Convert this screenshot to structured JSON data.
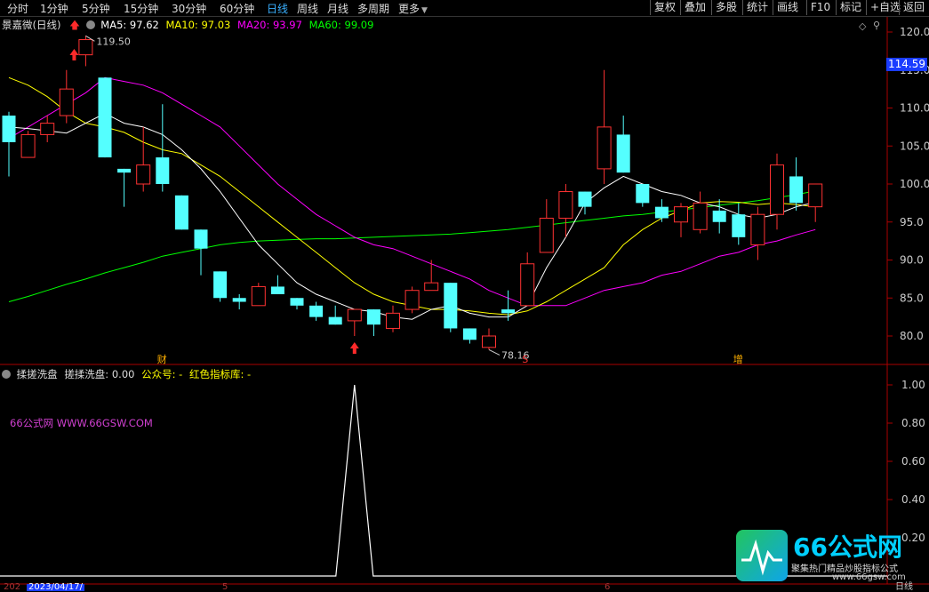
{
  "toolbar": {
    "tabs": [
      "分时",
      "1分钟",
      "5分钟",
      "15分钟",
      "30分钟",
      "60分钟",
      "日线",
      "周线",
      "月线",
      "多周期",
      "更多"
    ],
    "active_tab": "日线",
    "buttons": [
      "复权",
      "叠加",
      "多股",
      "统计",
      "画线",
      "F10",
      "标记",
      "+自选",
      "返回"
    ]
  },
  "main_legend": {
    "stock": "景嘉微(日线)",
    "ma5": "MA5: 97.62",
    "ma10": "MA10: 97.03",
    "ma20": "MA20: 93.97",
    "ma60": "MA60: 99.09",
    "colors": {
      "ma5": "#ffffff",
      "ma10": "#ffff00",
      "ma20": "#ff00ff",
      "ma60": "#00ff00"
    }
  },
  "price_axis": {
    "ticks": [
      "120.0",
      "115.0",
      "110.0",
      "105.0",
      "100.0",
      "95.0",
      "90.0",
      "85.0",
      "80.0"
    ],
    "current_price": "114.59",
    "high_label": "119.50",
    "low_label": "78.16"
  },
  "markers": {
    "cai": "财",
    "s": "S",
    "zeng": "增"
  },
  "sub_legend": {
    "name": "揉搓洗盘",
    "value": "搓揉洗盘: 0.00",
    "gzh": "公众号: -",
    "lib": "红色指标库: -"
  },
  "sub_axis": {
    "ticks": [
      "1.00",
      "0.80",
      "0.60",
      "0.40",
      "0.20"
    ]
  },
  "site_text": "66公式网 WWW.66GSW.COM",
  "bottom": {
    "date": "2023/04/17/",
    "year_prefix": "202",
    "tick_5": "5",
    "tick_6": "6",
    "right": "日线"
  },
  "watermark": {
    "logo": "66公式网",
    "sub": "聚集热门精品炒股指标公式",
    "url": "www.66gsw.com"
  },
  "chart_data": {
    "type": "candlestick",
    "ylim": [
      77,
      122
    ],
    "candles": [
      {
        "o": 109,
        "h": 109.5,
        "l": 101,
        "c": 105.5
      },
      {
        "o": 103.5,
        "h": 107,
        "l": 103.5,
        "c": 106.5
      },
      {
        "o": 106.5,
        "h": 109,
        "l": 105.5,
        "c": 108
      },
      {
        "o": 109,
        "h": 115,
        "l": 108,
        "c": 112.5
      },
      {
        "o": 117,
        "h": 119.5,
        "l": 115.5,
        "c": 119
      },
      {
        "o": 114,
        "h": 114,
        "l": 103.5,
        "c": 103.5
      },
      {
        "o": 102,
        "h": 102,
        "l": 97,
        "c": 101.5
      },
      {
        "o": 100,
        "h": 107.5,
        "l": 99,
        "c": 102.5
      },
      {
        "o": 103.5,
        "h": 110.5,
        "l": 99,
        "c": 100
      },
      {
        "o": 98.5,
        "h": 98.5,
        "l": 94,
        "c": 94
      },
      {
        "o": 94,
        "h": 94,
        "l": 88,
        "c": 91.5
      },
      {
        "o": 88.5,
        "h": 88.5,
        "l": 84.5,
        "c": 85
      },
      {
        "o": 85,
        "h": 85.5,
        "l": 83.5,
        "c": 84.5
      },
      {
        "o": 84,
        "h": 87,
        "l": 84,
        "c": 86.5
      },
      {
        "o": 86.5,
        "h": 88,
        "l": 85.5,
        "c": 85.5
      },
      {
        "o": 85,
        "h": 85,
        "l": 83.5,
        "c": 84
      },
      {
        "o": 84,
        "h": 84.5,
        "l": 82,
        "c": 82.5
      },
      {
        "o": 82.5,
        "h": 84,
        "l": 81.5,
        "c": 81.5
      },
      {
        "o": 82,
        "h": 83.5,
        "l": 80,
        "c": 83.5
      },
      {
        "o": 83.5,
        "h": 83.5,
        "l": 80,
        "c": 81.5
      },
      {
        "o": 81,
        "h": 84,
        "l": 80.5,
        "c": 83
      },
      {
        "o": 83.5,
        "h": 86.5,
        "l": 83,
        "c": 86
      },
      {
        "o": 86,
        "h": 90,
        "l": 86,
        "c": 87
      },
      {
        "o": 87,
        "h": 87,
        "l": 80.5,
        "c": 81
      },
      {
        "o": 81,
        "h": 81,
        "l": 79,
        "c": 79.5
      },
      {
        "o": 78.5,
        "h": 81,
        "l": 78.2,
        "c": 80
      },
      {
        "o": 83.5,
        "h": 86,
        "l": 82,
        "c": 83
      },
      {
        "o": 84,
        "h": 91,
        "l": 84,
        "c": 89.5
      },
      {
        "o": 91,
        "h": 98,
        "l": 91,
        "c": 95.5
      },
      {
        "o": 95.5,
        "h": 100,
        "l": 93,
        "c": 99
      },
      {
        "o": 99,
        "h": 99,
        "l": 96,
        "c": 97
      },
      {
        "o": 102,
        "h": 115,
        "l": 100,
        "c": 107.5
      },
      {
        "o": 106.5,
        "h": 109,
        "l": 101.5,
        "c": 101.5
      },
      {
        "o": 100,
        "h": 100,
        "l": 97,
        "c": 97.5
      },
      {
        "o": 97,
        "h": 98,
        "l": 95,
        "c": 95.5
      },
      {
        "o": 95,
        "h": 97.5,
        "l": 93,
        "c": 97
      },
      {
        "o": 94,
        "h": 99,
        "l": 93.5,
        "c": 97.5
      },
      {
        "o": 96.5,
        "h": 98,
        "l": 93.5,
        "c": 95
      },
      {
        "o": 96,
        "h": 97.5,
        "l": 92,
        "c": 93
      },
      {
        "o": 92,
        "h": 97,
        "l": 90,
        "c": 96
      },
      {
        "o": 96,
        "h": 104,
        "l": 94,
        "c": 102.5
      },
      {
        "o": 101,
        "h": 103.5,
        "l": 96.5,
        "c": 97.5
      },
      {
        "o": 97,
        "h": 100,
        "l": 95,
        "c": 100
      }
    ],
    "ma5": [
      107.5,
      107.3,
      107,
      106.7,
      108,
      109.3,
      108,
      107.5,
      106.5,
      104.5,
      102,
      99,
      95.5,
      92,
      89.5,
      87,
      85.5,
      84.5,
      83.5,
      83.2,
      82.5,
      82.2,
      83.5,
      84,
      83,
      82.5,
      82.5,
      84,
      89,
      93,
      97.5,
      99.5,
      101,
      100,
      99,
      98.5,
      97.5,
      97,
      96,
      95.5,
      96,
      97,
      97.6
    ],
    "ma10": [
      114,
      113,
      111.5,
      109.5,
      108,
      107.5,
      106.8,
      105.5,
      104.5,
      104,
      102.5,
      101,
      99,
      97,
      95,
      93,
      91,
      89,
      87,
      85.5,
      84.5,
      84,
      83.5,
      83.5,
      83.3,
      83,
      82.8,
      83.3,
      84.5,
      86,
      87.5,
      89,
      92,
      94,
      95.5,
      96.5,
      97.5,
      97.7,
      97.6,
      97.3,
      97.5,
      97.3,
      97
    ],
    "ma20": [
      106,
      107.5,
      109,
      110.5,
      112,
      114,
      113.5,
      113,
      112,
      110.5,
      109,
      107.5,
      105,
      102.5,
      100,
      98,
      96,
      94.5,
      93,
      92,
      91.5,
      90.5,
      89.5,
      88.5,
      87.5,
      86,
      85,
      84,
      84,
      84,
      85,
      86,
      86.5,
      87,
      88,
      88.5,
      89.5,
      90.5,
      91,
      92,
      92.5,
      93.3,
      94
    ],
    "ma60": [
      84.5,
      85.2,
      86,
      86.8,
      87.5,
      88.3,
      89,
      89.7,
      90.5,
      91,
      91.5,
      92,
      92.3,
      92.5,
      92.6,
      92.7,
      92.8,
      92.8,
      92.9,
      93,
      93.1,
      93.2,
      93.3,
      93.4,
      93.6,
      93.8,
      94,
      94.3,
      94.6,
      94.9,
      95.2,
      95.5,
      95.8,
      96,
      96.3,
      96.6,
      96.9,
      97.2,
      97.5,
      97.8,
      98.2,
      98.6,
      99.1
    ],
    "indicator": {
      "name": "搓揉洗盘",
      "ylim": [
        0,
        1.05
      ],
      "spike_index": 18,
      "spike_value": 1.0
    }
  }
}
